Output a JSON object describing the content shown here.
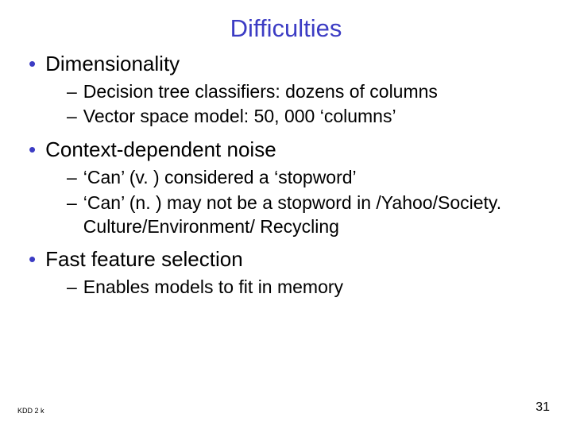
{
  "title": "Difficulties",
  "bullets": [
    {
      "text": "Dimensionality",
      "sub": [
        "Decision tree classifiers: dozens of columns",
        "Vector space model: 50, 000 ‘columns’"
      ]
    },
    {
      "text": "Context-dependent noise",
      "sub": [
        "‘Can’ (v. ) considered a ‘stopword’",
        "‘Can’ (n. ) may not be a stopword in /Yahoo/Society. Culture/Environment/ Recycling"
      ]
    },
    {
      "text": "Fast feature selection",
      "sub": [
        "Enables models to fit in memory"
      ]
    }
  ],
  "footer": {
    "left": "KDD 2 k",
    "right": "31"
  }
}
